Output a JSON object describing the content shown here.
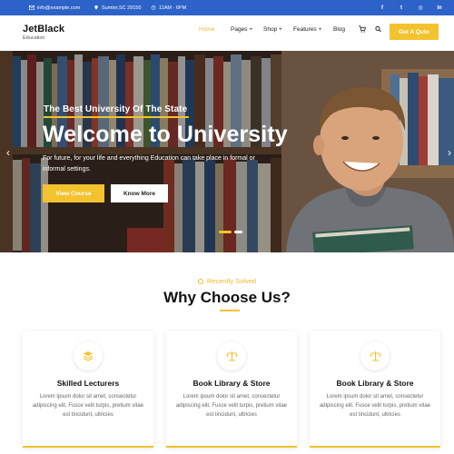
{
  "topbar": {
    "email": "info@example.com",
    "location": "Sumter,SC 29150",
    "hours": "11AM - 6PM",
    "socials": [
      {
        "icon": "facebook-icon",
        "glyph": "f"
      },
      {
        "icon": "twitter-icon",
        "glyph": "t"
      },
      {
        "icon": "instagram-icon",
        "glyph": "◎"
      },
      {
        "icon": "linkedin-icon",
        "glyph": "in"
      }
    ]
  },
  "header": {
    "logo_title": "JetBlack",
    "logo_subtitle": "Education",
    "nav": [
      {
        "label": "Home",
        "active": true
      },
      {
        "label": "Pages +",
        "active": false
      },
      {
        "label": "Shop +",
        "active": false
      },
      {
        "label": "Features +",
        "active": false
      },
      {
        "label": "Blog",
        "active": false
      }
    ],
    "cart_icon": "cart-icon",
    "search_icon": "search-icon",
    "quote_button": "Get A Quto"
  },
  "hero": {
    "eyebrow": "The Best University Of The State",
    "title": "Welcome to University",
    "description": "For future, for your life and everything Education can take place in formal or informal settings.",
    "primary_button": "View Course",
    "secondary_button": "Know More",
    "prev_arrow": "‹",
    "next_arrow": "›"
  },
  "section": {
    "tag": "Recently Solved",
    "title": "Why Choose Us?"
  },
  "cards": [
    {
      "icon": "layers-icon",
      "title": "Skilled Lecturers",
      "text": "Lorem ipsum dolor sit amet, consectetur adipiscing elit. Fusce velit turpis, pretium vitae est tincidunt, ultricies"
    },
    {
      "icon": "scale-icon",
      "title": "Book Library & Store",
      "text": "Lorem ipsum dolor sit amet, consectetur adipiscing elit. Fusce velit turpis, pretium vitae est tincidunt, ultricies"
    },
    {
      "icon": "scale-icon",
      "title": "Book Library & Store",
      "text": "Lorem ipsum dolor sit amet, consectetur adipiscing elit. Fusce velit turpis, pretium vitae est tincidunt, ultricies"
    }
  ],
  "colors": {
    "accent": "#f3c22f",
    "topbar": "#2d63c8"
  }
}
